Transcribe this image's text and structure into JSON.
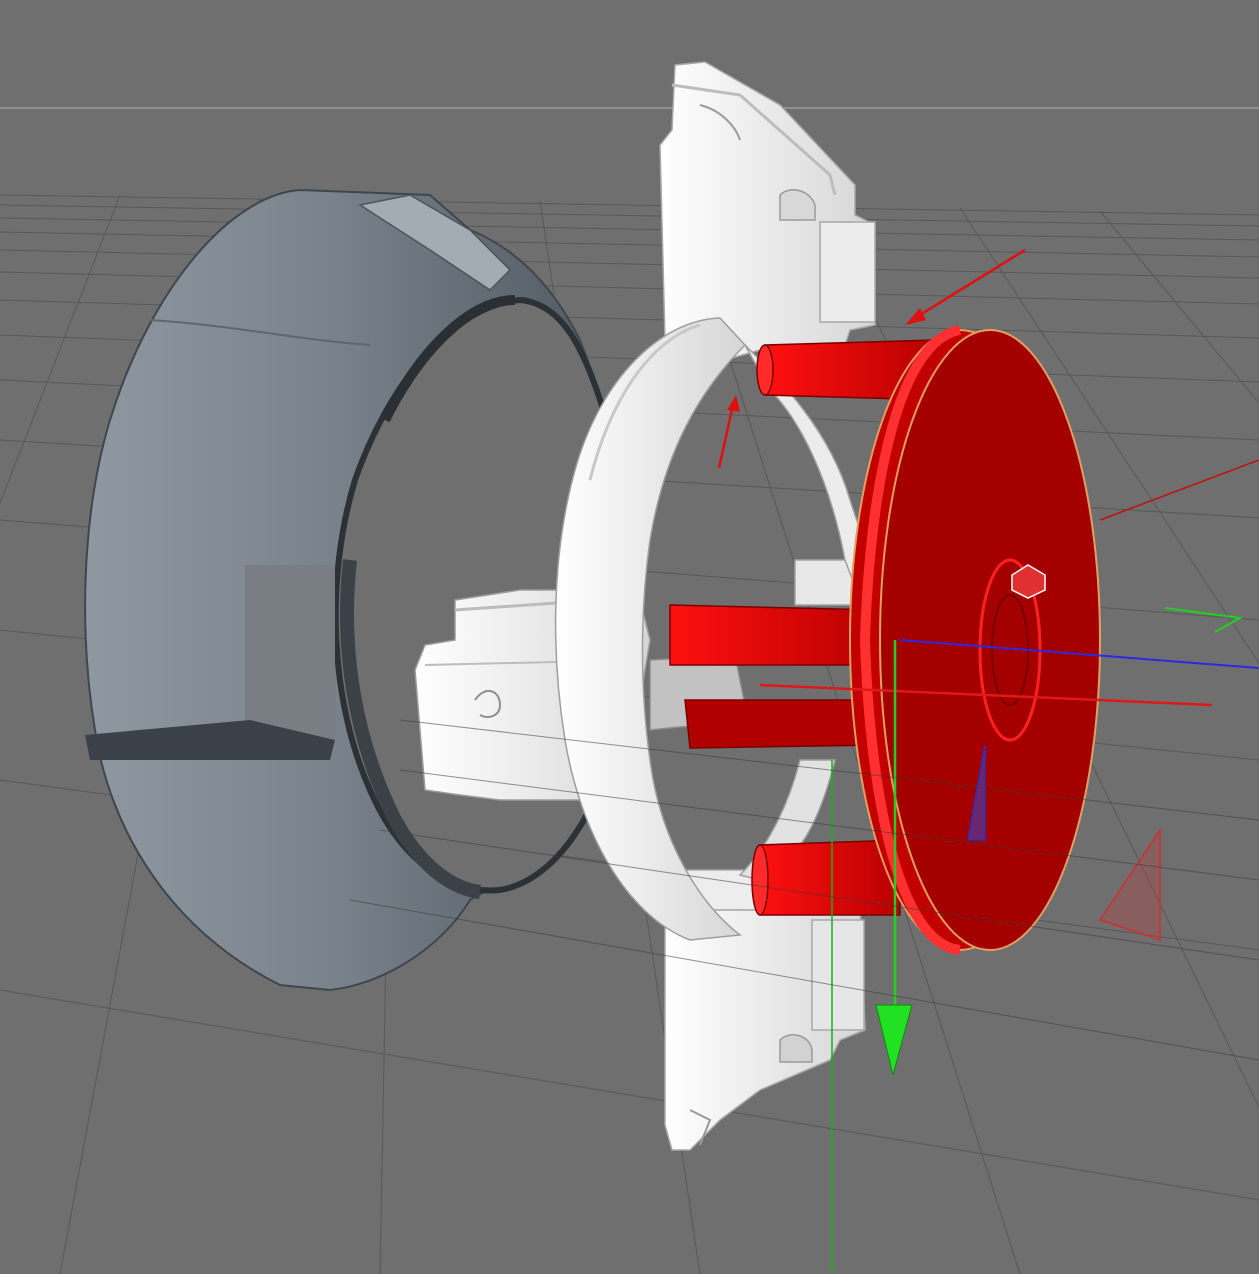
{
  "viewport": {
    "background": "#6f6f6f",
    "horizon_line_color": "#9a9a9a",
    "grid_color": "#4a4a4a"
  },
  "colors": {
    "selected_part": "#d40000",
    "selected_part_dark": "#8a0000",
    "selection_outline": "#e0a060",
    "white_parts": "#f2f2f2",
    "white_shade": "#c9c9c9",
    "gray_ring": "#7d868f",
    "gray_ring_dark": "#4b535b",
    "axis_x": "#e02020",
    "axis_y": "#20d020",
    "axis_z": "#2020e0",
    "annotation_arrow": "#e01010"
  },
  "objects": [
    {
      "name": "gray-outer-ring",
      "icon": "ring-shell"
    },
    {
      "name": "white-mount-bracket",
      "icon": "bracket"
    },
    {
      "name": "white-split-ring",
      "icon": "split-ring"
    },
    {
      "name": "red-cap-selected",
      "icon": "cap-with-pins"
    }
  ],
  "gizmo": {
    "icon": "move-gizmo",
    "axes": [
      "x",
      "y",
      "z"
    ]
  },
  "annotations": [
    {
      "icon": "annotation-arrow-upper"
    },
    {
      "icon": "annotation-arrow-lower"
    }
  ]
}
